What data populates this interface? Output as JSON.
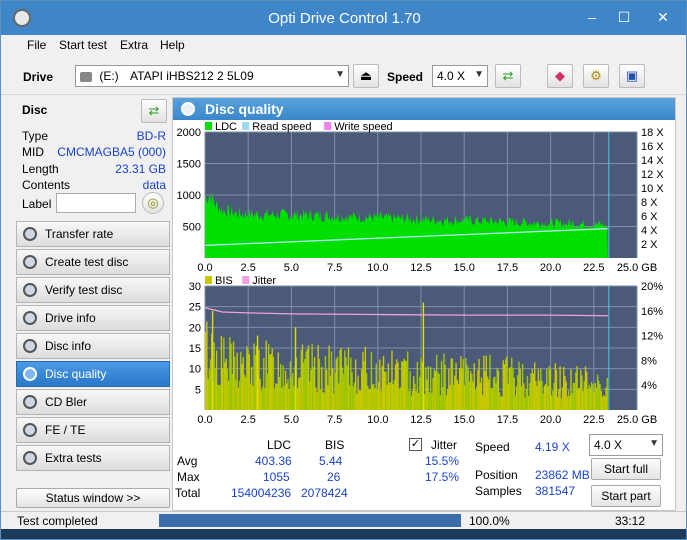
{
  "window": {
    "title": "Opti Drive Control 1.70",
    "controls": {
      "minimize": "–",
      "maximize": "☐",
      "close": "✕"
    }
  },
  "menu": [
    "File",
    "Start test",
    "Extra",
    "Help"
  ],
  "toolbar": {
    "drive_label": "Drive",
    "drive_letter": "(E:)",
    "drive_value": "ATAPI iHBS212  2 5L09",
    "speed_label": "Speed",
    "speed_value": "4.0 X"
  },
  "disc": {
    "heading": "Disc",
    "fields": [
      {
        "label": "Type",
        "value": "BD-R"
      },
      {
        "label": "MID",
        "value": "CMCMAGBA5 (000)"
      },
      {
        "label": "Length",
        "value": "23.31 GB"
      },
      {
        "label": "Contents",
        "value": "data"
      }
    ],
    "label_field": "Label",
    "label_value": ""
  },
  "nav": [
    {
      "label": "Transfer rate",
      "active": false
    },
    {
      "label": "Create test disc",
      "active": false
    },
    {
      "label": "Verify test disc",
      "active": false
    },
    {
      "label": "Drive info",
      "active": false
    },
    {
      "label": "Disc info",
      "active": false
    },
    {
      "label": "Disc quality",
      "active": true
    },
    {
      "label": "CD Bler",
      "active": false
    },
    {
      "label": "FE / TE",
      "active": false
    },
    {
      "label": "Extra tests",
      "active": false
    }
  ],
  "status_window_button": "Status window >>",
  "panel_title": "Disc quality",
  "chart_data": [
    {
      "type": "area",
      "legend": [
        "LDC",
        "Read speed",
        "Write speed"
      ],
      "colors": {
        "LDC": "#00e000",
        "Read speed": "#9ad8f0",
        "Write speed": "#f080f0"
      },
      "x_ticks": [
        "0.0",
        "2.5",
        "5.0",
        "7.5",
        "10.0",
        "12.5",
        "15.0",
        "17.5",
        "20.0",
        "22.5",
        "25.0 GB"
      ],
      "xlim": [
        0,
        25
      ],
      "y_left_ticks": [
        "2000",
        "1500",
        "1000",
        "500"
      ],
      "ylim_left": [
        0,
        2000
      ],
      "y_right_ticks": [
        "18 X",
        "16 X",
        "14 X",
        "12 X",
        "10 X",
        "8 X",
        "6 X",
        "4 X",
        "2 X"
      ],
      "ylim_right": [
        0,
        18
      ],
      "ldc_x": [
        0,
        0.3,
        0.6,
        1,
        2,
        3,
        4,
        5,
        6,
        7,
        8,
        9,
        10,
        11,
        12,
        13,
        14,
        15,
        16,
        17,
        18,
        19,
        20,
        21,
        22,
        23,
        23.31
      ],
      "ldc_y": [
        950,
        1000,
        850,
        760,
        700,
        690,
        690,
        680,
        680,
        670,
        660,
        650,
        640,
        630,
        620,
        610,
        600,
        600,
        590,
        580,
        570,
        560,
        550,
        550,
        540,
        530,
        480
      ],
      "read_speed_x": [
        0,
        23.31
      ],
      "read_speed_y": [
        1.8,
        4.2
      ]
    },
    {
      "type": "area",
      "legend": [
        "BIS",
        "Jitter"
      ],
      "colors": {
        "BIS": "#c8c800",
        "Jitter": "#f0a0e0"
      },
      "x_ticks": [
        "0.0",
        "2.5",
        "5.0",
        "7.5",
        "10.0",
        "12.5",
        "15.0",
        "17.5",
        "20.0",
        "22.5",
        "25.0 GB"
      ],
      "xlim": [
        0,
        25
      ],
      "y_left_ticks": [
        "30",
        "25",
        "20",
        "15",
        "10",
        "5"
      ],
      "ylim_left": [
        0,
        30
      ],
      "y_right_ticks": [
        "20%",
        "16%",
        "12%",
        "8%",
        "4%"
      ],
      "ylim_right": [
        0,
        20
      ],
      "bis_x": [
        0,
        1,
        2,
        4,
        6,
        8,
        10,
        12,
        14,
        16,
        18,
        20,
        22,
        23.31
      ],
      "bis_y": [
        14,
        11,
        10,
        10,
        9.5,
        9,
        9,
        8.5,
        8,
        8,
        7.5,
        7,
        6.5,
        6
      ],
      "jitter_x": [
        0,
        1,
        2,
        5,
        10,
        15,
        20,
        23.31
      ],
      "jitter_y": [
        16.5,
        15.8,
        15.7,
        15.5,
        15.4,
        15.3,
        15.3,
        15.2
      ]
    }
  ],
  "stats": {
    "col_ldc": "LDC",
    "col_bis": "BIS",
    "col_jitter": "Jitter",
    "jitter_checked": true,
    "rows": [
      {
        "label": "Avg",
        "ldc": "403.36",
        "bis": "5.44",
        "jitter": "15.5%"
      },
      {
        "label": "Max",
        "ldc": "1055",
        "bis": "26",
        "jitter": "17.5%"
      },
      {
        "label": "Total",
        "ldc": "154004236",
        "bis": "2078424",
        "jitter": ""
      }
    ],
    "speed_label": "Speed",
    "speed_value": "4.19 X",
    "speed_select": "4.0 X",
    "position_label": "Position",
    "position_value": "23862 MB",
    "samples_label": "Samples",
    "samples_value": "381547",
    "start_full": "Start full",
    "start_part": "Start part"
  },
  "status": {
    "text": "Test completed",
    "progress": 1.0,
    "progress_text": "100.0%",
    "time": "33:12"
  }
}
